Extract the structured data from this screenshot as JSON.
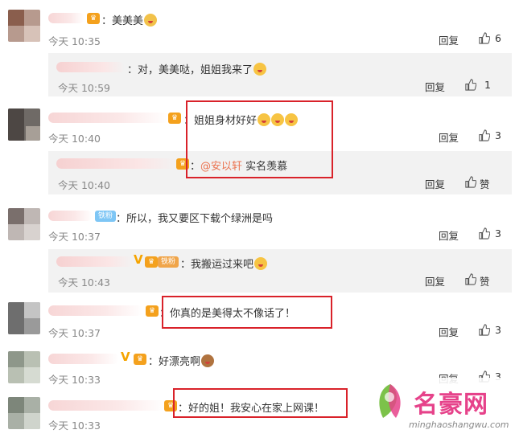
{
  "labels": {
    "reply": "回复",
    "like_text": "赞"
  },
  "comments": [
    {
      "text": "美美美",
      "time": "今天 10:35",
      "likes": "6"
    },
    {
      "text": "对，美美哒，姐姐我来了",
      "time": "今天 10:59",
      "likes": "1"
    },
    {
      "text": "姐姐身材好好",
      "time": "今天 10:40",
      "likes": "3"
    },
    {
      "mention": "@安以轩",
      "text": " 实名羡慕",
      "time": "今天 10:40"
    },
    {
      "badge": "铁粉",
      "text": "所以，我又要区下载个绿洲是吗",
      "time": "今天 10:37",
      "likes": "3"
    },
    {
      "text": "我搬运过来吧",
      "time": "今天 10:43"
    },
    {
      "text": "你真的是美得太不像话了！",
      "time": "今天 10:37",
      "likes": "3"
    },
    {
      "text": "好漂亮啊",
      "time": "今天 10:33",
      "likes": "3"
    },
    {
      "text": "好的姐！我安心在家上网课！",
      "time": "今天 10:33"
    }
  ],
  "watermark": {
    "brand": "名豪网",
    "url": "minghaoshangwu.com"
  },
  "colors": {
    "highlight_border": "#d9222a",
    "mention": "#eb7350",
    "vip": "#f4a11d",
    "brand": "#e6428a"
  }
}
